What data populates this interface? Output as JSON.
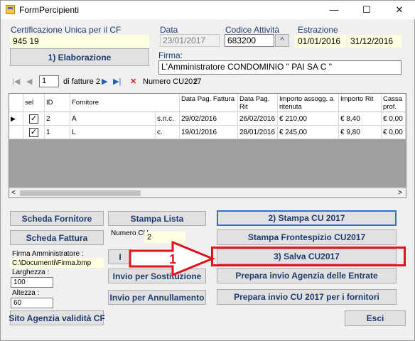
{
  "window": {
    "title": "FormPercipienti",
    "minimize": "—",
    "maximize": "☐",
    "close": "✕"
  },
  "certificazione": {
    "label": "Certificazione Unica per il CF",
    "value": "945             19"
  },
  "data": {
    "label": "Data",
    "value": "23/01/2017"
  },
  "codice_attivita": {
    "label": "Codice Attività",
    "value": "683200",
    "spin_symbol": "^"
  },
  "estrazione": {
    "label": "Estrazione",
    "from": "01/01/2016",
    "to": "31/12/2016"
  },
  "elaborazione_button": "1) Elaborazione",
  "firma": {
    "label": "Firma:",
    "value": "L'Amministratore CONDOMINIO \" PAI                  SA C \""
  },
  "navigator": {
    "first": "|◀",
    "prev": "◀",
    "position": "1",
    "of_label": "di fatture 2",
    "next": "▶",
    "last": "▶|",
    "delete": "✕",
    "numero_label": "Numero CU2017",
    "numero_value": "2"
  },
  "grid": {
    "columns": [
      "sel",
      "ID",
      "Fornitore",
      "Data Pag. Fattura",
      "Data Pag. Rit",
      "Importo assogg. a ritenuta",
      "Importo Rit",
      "Cassa prof."
    ],
    "rows": [
      {
        "indicator": "▶",
        "sel": "✓",
        "id": "2",
        "fornitore": "A",
        "fornitore_tail": "s.n.c.",
        "data_fattura": "29/02/2016",
        "data_rit": "26/02/2016",
        "importo": "€ 210,00",
        "importo_rit": "€ 8,40",
        "cassa": "€ 0,00"
      },
      {
        "indicator": "",
        "sel": "✓",
        "id": "1",
        "fornitore": "L",
        "fornitore_tail": "c.",
        "data_fattura": "19/01/2016",
        "data_rit": "28/01/2016",
        "importo": "€ 245,00",
        "importo_rit": "€ 9,80",
        "cassa": "€ 0,00"
      }
    ],
    "scroll_left": "<",
    "scroll_right": ">"
  },
  "buttons": {
    "scheda_fornitore": "Scheda Fornitore",
    "stampa_lista": "Stampa Lista",
    "stampa_cu": "2) Stampa CU 2017",
    "scheda_fattura": "Scheda Fattura",
    "stampa_frontespizio": "Stampa Frontespizio CU2017",
    "hidden_i": "I",
    "salva_cu": "3) Salva CU2017",
    "invio_sostituzione": "Invio per Sostituzione",
    "prepara_agenzia": "Prepara  invio Agenzia delle Entrate",
    "invio_annullamento": "Invio per Annullamento",
    "prepara_fornitori": "Prepara invio CU 2017 per i fornitori",
    "sito_agenzia": "Sito Agenzia validità CF",
    "esci": "Esci"
  },
  "numero_cu": {
    "label": "Numero CU",
    "value": "2"
  },
  "firma_amministratore": {
    "label": "Firma Amministratore :",
    "value": "C:\\Documenti\\Firma.bmp"
  },
  "larghezza": {
    "label": "Larghezza :",
    "value": "100"
  },
  "altezza": {
    "label": "Altezza :",
    "value": "60"
  },
  "annotation": {
    "number": "1",
    "color": "#e0141e"
  }
}
